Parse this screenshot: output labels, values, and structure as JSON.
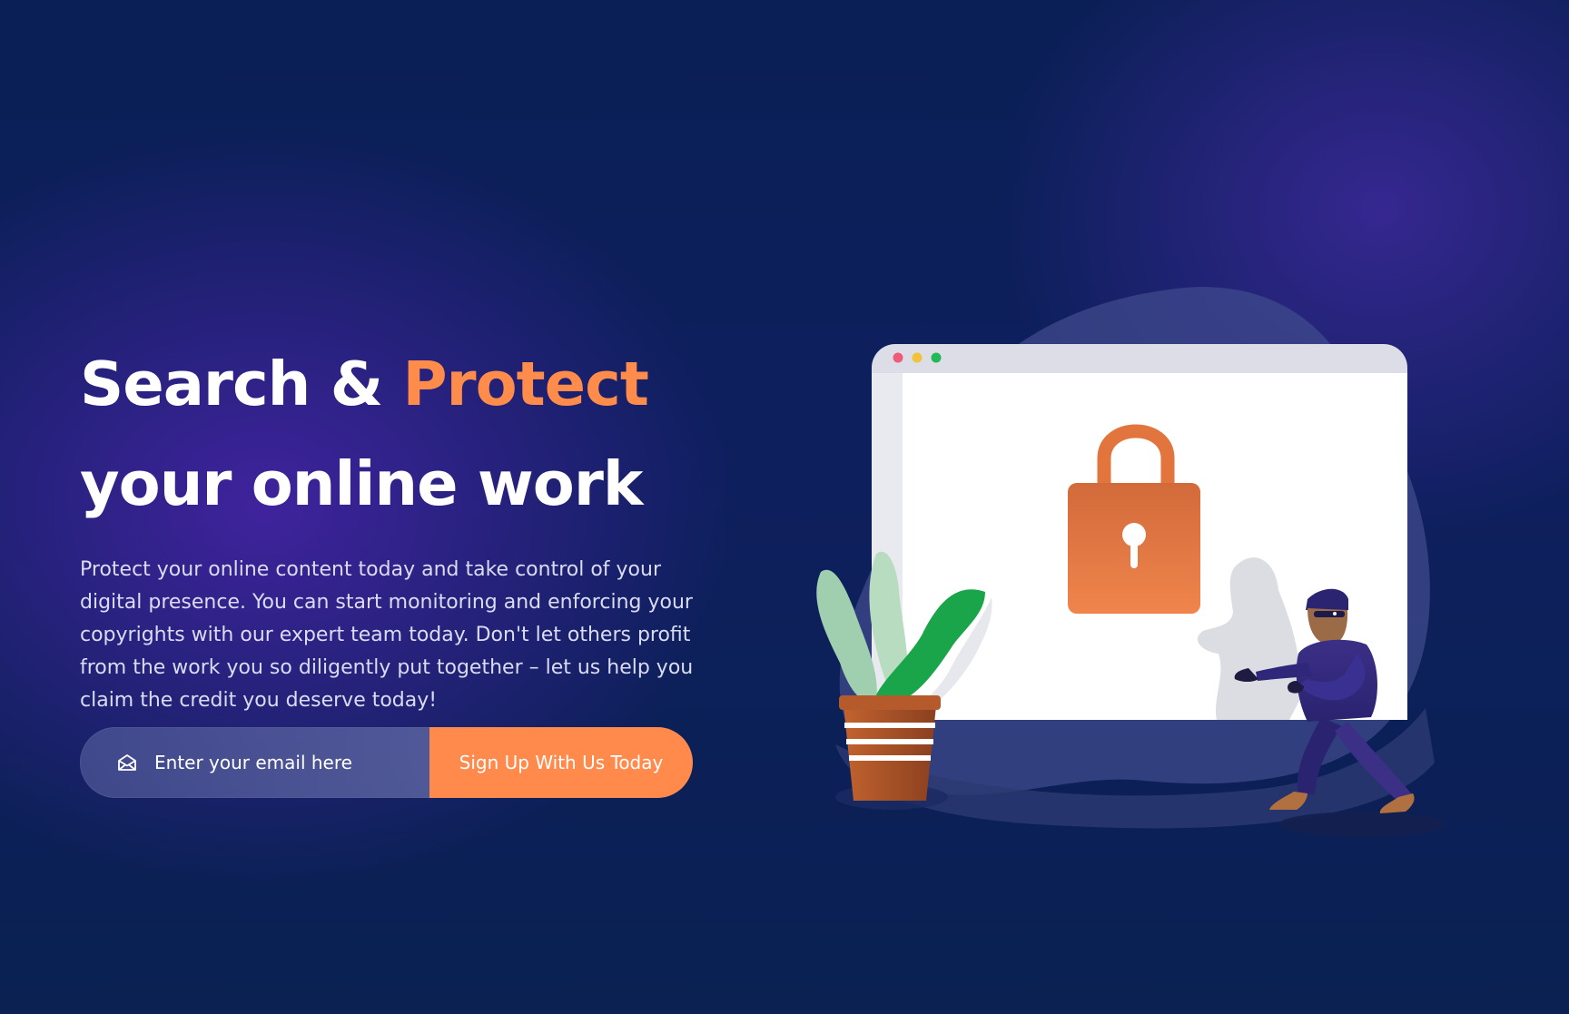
{
  "hero": {
    "headline_part1": "Search & ",
    "headline_accent": "Protect",
    "headline_line2": "your online work",
    "subtitle": "Protect your online content today and take control of your digital presence. You can start monitoring and enforcing your copyrights with our expert team today. Don't let others profit from the work you so diligently put together – let us help you claim the credit you deserve today!"
  },
  "signup": {
    "email_placeholder": "Enter your email here",
    "email_icon": "mail-icon",
    "button_label": "Sign Up With Us Today"
  },
  "illustration": {
    "subject": "browser window with padlock, potted plant, thief figure",
    "icons": [
      "padlock-icon",
      "plant",
      "thief"
    ]
  },
  "colors": {
    "accent": "#ff8c4a",
    "background_dark": "#0a1f55",
    "background_purple": "#3a25a0",
    "text_primary": "#ffffff",
    "text_secondary": "#d9dcf2"
  }
}
